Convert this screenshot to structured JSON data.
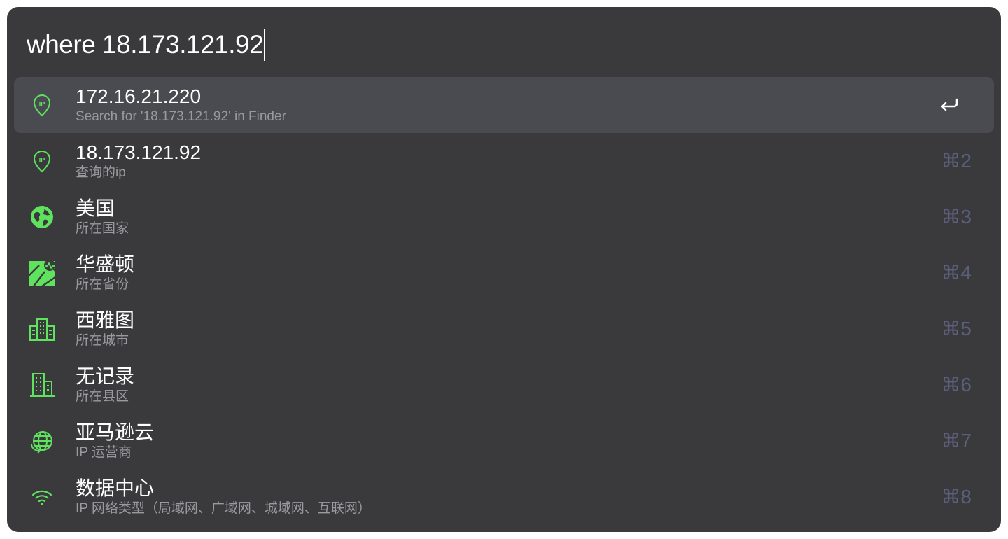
{
  "search": {
    "query": "where 18.173.121.92"
  },
  "accent_color": "#5fe35f",
  "results": [
    {
      "title": "172.16.21.220",
      "subtitle": "Search for '18.173.121.92' in Finder",
      "icon": "ip-pin-icon",
      "shortcut": "",
      "selected": true
    },
    {
      "title": "18.173.121.92",
      "subtitle": "查询的ip",
      "icon": "ip-pin-icon",
      "shortcut": "⌘2"
    },
    {
      "title": "美国",
      "subtitle": "所在国家",
      "icon": "globe-icon",
      "shortcut": "⌘3"
    },
    {
      "title": "华盛顿",
      "subtitle": "所在省份",
      "icon": "map-icon",
      "shortcut": "⌘4"
    },
    {
      "title": "西雅图",
      "subtitle": "所在城市",
      "icon": "city-icon",
      "shortcut": "⌘5"
    },
    {
      "title": "无记录",
      "subtitle": "所在县区",
      "icon": "building-icon",
      "shortcut": "⌘6"
    },
    {
      "title": "亚马逊云",
      "subtitle": "IP 运营商",
      "icon": "network-globe-icon",
      "shortcut": "⌘7"
    },
    {
      "title": "数据中心",
      "subtitle": "IP 网络类型（局域网、广域网、城域网、互联网）",
      "icon": "wifi-icon",
      "shortcut": "⌘8"
    }
  ]
}
